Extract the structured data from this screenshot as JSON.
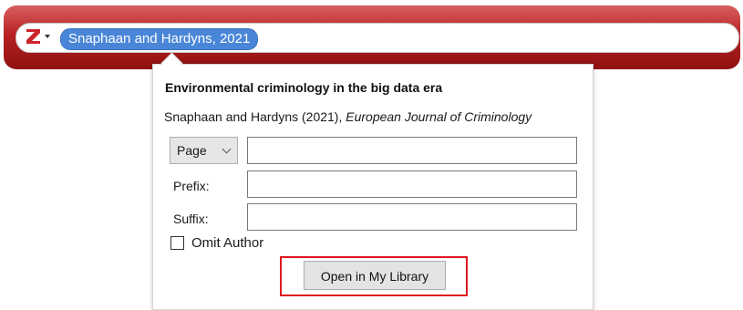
{
  "citation_bar": {
    "logo_icon": "zotero-z-icon",
    "accent": "#b82222",
    "bubble_label": "Snaphaan and Hardyns, 2021"
  },
  "panel": {
    "title": "Environmental criminology in the big data era",
    "source_prefix": "Snaphaan and Hardyns (2021), ",
    "journal": "European Journal of Criminology",
    "locator_selected": "Page",
    "locator_value": "",
    "prefix_label": "Prefix:",
    "prefix_value": "",
    "suffix_label": "Suffix:",
    "suffix_value": "",
    "omit_author_label": "Omit Author",
    "omit_author_checked": false,
    "open_button_label": "Open in My Library",
    "highlight_color": "#e0161c"
  }
}
